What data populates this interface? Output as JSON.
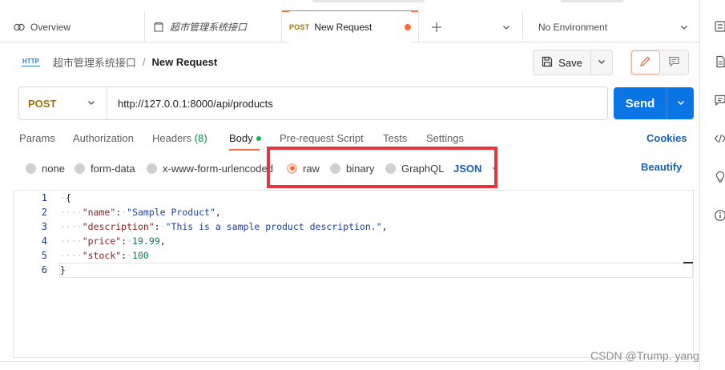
{
  "tabs": [
    {
      "label": "Overview",
      "icon": "overview-icon"
    },
    {
      "label": "超市管理系统接口",
      "icon": "collection-icon"
    },
    {
      "method": "POST",
      "label": "New Request",
      "unsaved": true
    }
  ],
  "environment": {
    "label": "No Environment"
  },
  "breadcrumb": {
    "icon_label": "HTTP",
    "collection": "超市管理系统接口",
    "separator": "/",
    "current": "New Request"
  },
  "toolbar": {
    "save_label": "Save"
  },
  "request": {
    "method": "POST",
    "url": "http://127.0.0.1:8000/api/products",
    "send_label": "Send"
  },
  "request_tabs": [
    {
      "label": "Params"
    },
    {
      "label": "Authorization"
    },
    {
      "label": "Headers",
      "count": "(8)"
    },
    {
      "label": "Body",
      "active": true
    },
    {
      "label": "Pre-request Script"
    },
    {
      "label": "Tests"
    },
    {
      "label": "Settings"
    }
  ],
  "cookies_label": "Cookies",
  "body_types": [
    {
      "label": "none"
    },
    {
      "label": "form-data"
    },
    {
      "label": "x-www-form-urlencoded"
    },
    {
      "label": "raw",
      "selected": true
    },
    {
      "label": "binary"
    },
    {
      "label": "GraphQL"
    }
  ],
  "raw_format": "JSON",
  "beautify_label": "Beautify",
  "editor": {
    "line_numbers": [
      "1",
      "2",
      "3",
      "4",
      "5",
      "6"
    ],
    "open_brace": "{",
    "close_brace": "}",
    "fields": [
      {
        "key": "\"name\"",
        "value": "\"Sample Product\"",
        "value_type": "string"
      },
      {
        "key": "\"description\"",
        "value": "\"This is a sample product description.\"",
        "value_type": "string"
      },
      {
        "key": "\"price\"",
        "value": "19.99",
        "value_type": "number"
      },
      {
        "key": "\"stock\"",
        "value": "100",
        "value_type": "number"
      }
    ]
  },
  "watermark": "CSDN @Trump. yang",
  "colors": {
    "accent": "#ff6c37",
    "send": "#0b75e6",
    "post": "#a77300",
    "highlight": "#e8343c"
  }
}
